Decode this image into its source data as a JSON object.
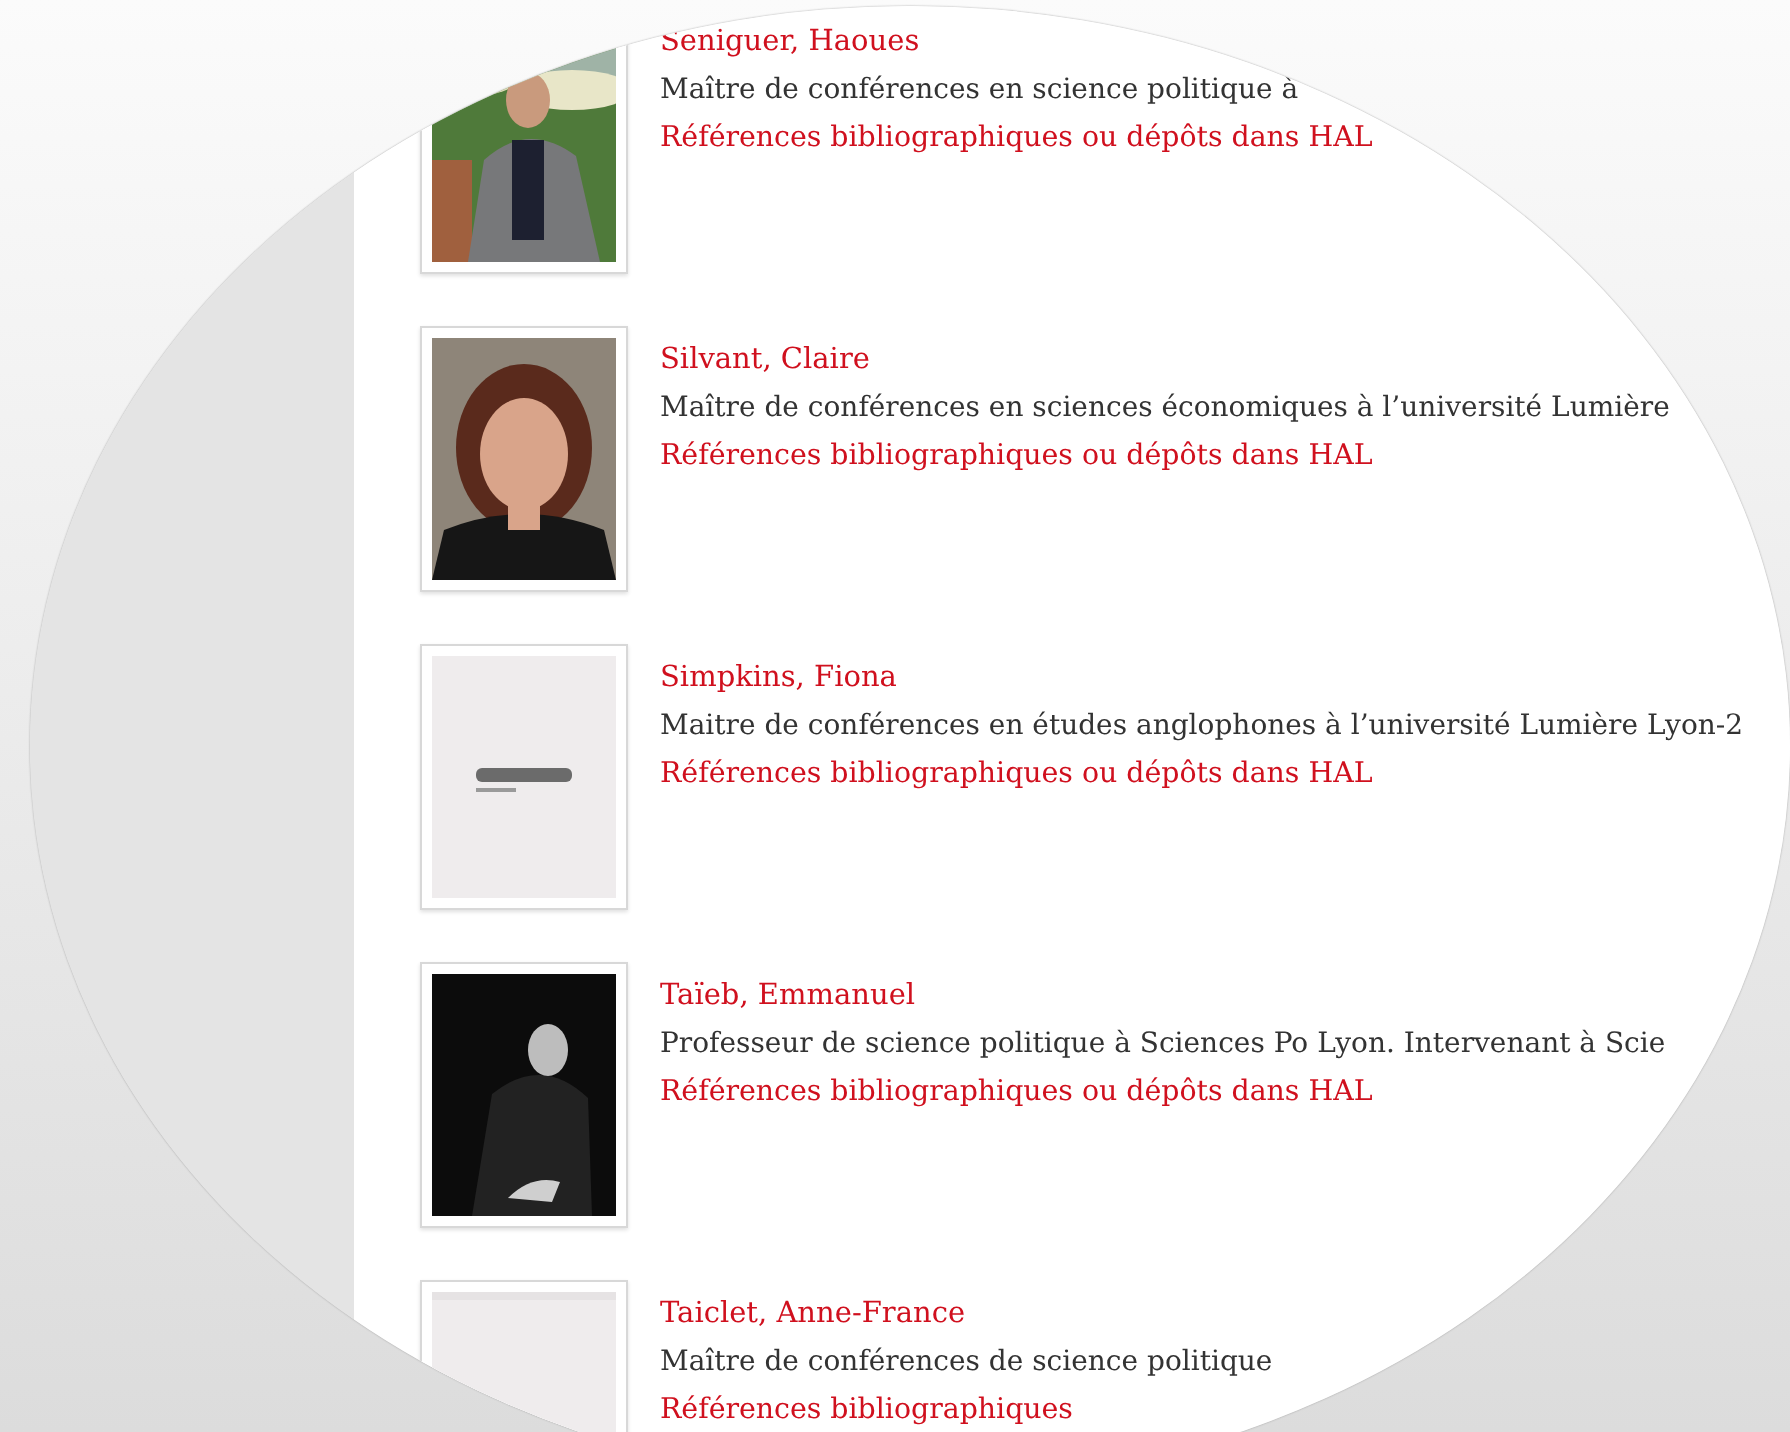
{
  "people": [
    {
      "name": "Seniguer, Haoues",
      "description": "Maître de conférences en science politique à",
      "link": "Références bibliographiques ou dépôts dans HAL"
    },
    {
      "name": "Silvant, Claire",
      "description": "Maître de conférences en sciences économiques à l’université Lumière",
      "link": "Références bibliographiques ou dépôts dans HAL"
    },
    {
      "name": "Simpkins, Fiona",
      "description": "Maitre de conférences en études anglophones à l’université Lumière Lyon-2",
      "link": "Références bibliographiques ou dépôts dans HAL"
    },
    {
      "name": "Taïeb, Emmanuel",
      "description": "Professeur de science politique à Sciences Po Lyon. Intervenant à Scie",
      "link": "Références bibliographiques ou dépôts dans HAL"
    },
    {
      "name": "Taiclet, Anne-France",
      "description": "Maître de conférences de science politique",
      "link": "Références bibliographiques"
    }
  ]
}
